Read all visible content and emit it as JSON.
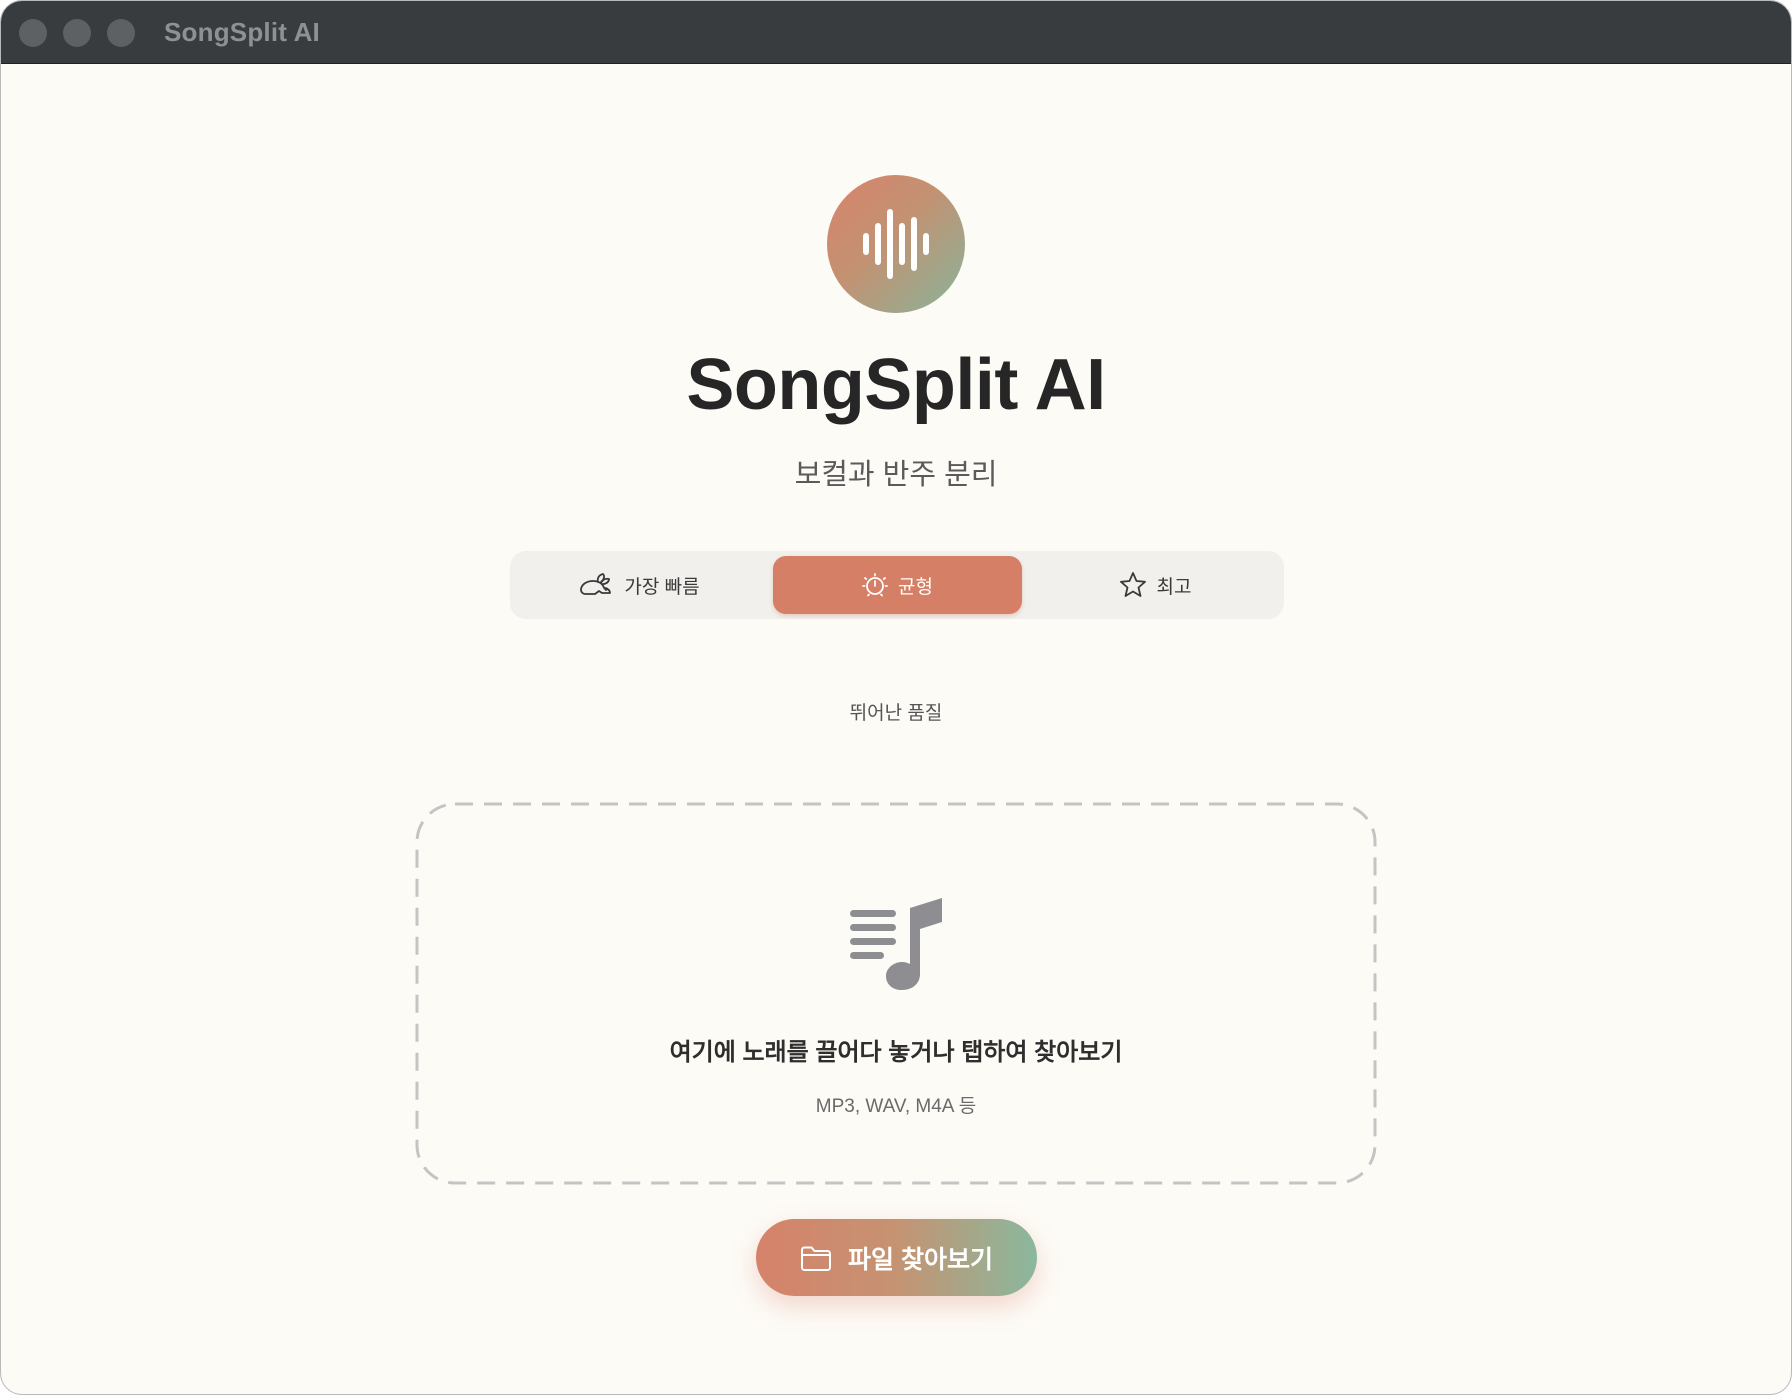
{
  "window": {
    "title": "SongSplit AI"
  },
  "header": {
    "logo_icon": "waveform-icon",
    "title": "SongSplit AI",
    "subtitle": "보컬과 반주 분리"
  },
  "quality_modes": {
    "options": [
      {
        "label": "가장 빠름",
        "icon": "rabbit-icon",
        "selected": false
      },
      {
        "label": "균형",
        "icon": "timer-icon",
        "selected": true
      },
      {
        "label": "최고",
        "icon": "star-icon",
        "selected": false
      }
    ],
    "description": "뛰어난 품질"
  },
  "dropzone": {
    "icon": "music-list-icon",
    "title": "여기에 노래를 끌어다 놓거나 탭하여 찾아보기",
    "formats": "MP3, WAV, M4A 등"
  },
  "browse_button": {
    "icon": "folder-icon",
    "label": "파일 찾아보기"
  },
  "colors": {
    "accent": "#d47f66",
    "gradient_start": "#d6826a",
    "gradient_end": "#8ab89d",
    "background": "#fdfbf6",
    "titlebar": "#383c3f"
  }
}
